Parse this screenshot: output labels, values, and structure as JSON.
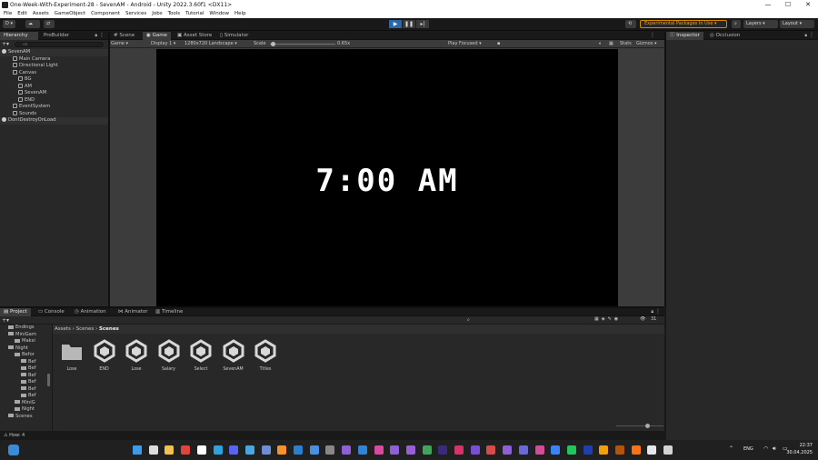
{
  "window": {
    "title": "One-Week-With-Experiment-28 - SevenAM - Android - Unity 2022.3.60f1 <DX11>",
    "min": "—",
    "max": "☐",
    "close": "✕"
  },
  "menu": [
    "File",
    "Edit",
    "Assets",
    "GameObject",
    "Component",
    "Services",
    "Jobs",
    "Tools",
    "Tutorial",
    "Window",
    "Help"
  ],
  "toolbar": {
    "account": "D ▾",
    "experimental": "Experimental Packages In Use ▾",
    "layers": "Layers",
    "layout": "Layout"
  },
  "hierarchy": {
    "tabs": [
      "Hierarchy",
      "ProBuilder"
    ],
    "search_placeholder": "All",
    "items": [
      {
        "label": "SevenAM",
        "indent": 0
      },
      {
        "label": "Main Camera",
        "indent": 2
      },
      {
        "label": "Directional Light",
        "indent": 2
      },
      {
        "label": "Canvas",
        "indent": 2
      },
      {
        "label": "BG",
        "indent": 3
      },
      {
        "label": "AM",
        "indent": 3
      },
      {
        "label": "SevenAM",
        "indent": 3
      },
      {
        "label": "END",
        "indent": 3
      },
      {
        "label": "EventSystem",
        "indent": 2
      },
      {
        "label": "Sounds",
        "indent": 2
      },
      {
        "label": "DontDestroyOnLoad",
        "indent": 0
      }
    ]
  },
  "game": {
    "tabs": [
      "Scene",
      "Game",
      "Asset Store",
      "Simulator"
    ],
    "mode": "Game",
    "display": "Display 1",
    "resolution": "1280x720 Landscape",
    "scale_label": "Scale",
    "scale_value": "0.65x",
    "play_focused": "Play Focused",
    "stats": "Stats",
    "gizmos": "Gizmos",
    "clock_text": "7:00 AM"
  },
  "inspector": {
    "tabs": [
      "Inspector",
      "Occlusion"
    ]
  },
  "project": {
    "tabs": [
      "Project",
      "Console",
      "Animation",
      "Animator",
      "Timeline"
    ],
    "breadcrumb": [
      "Assets",
      "Scenes",
      "Scenes"
    ],
    "count": "31",
    "tree": [
      {
        "label": "Endings",
        "indent": 1
      },
      {
        "label": "MiniGam",
        "indent": 1
      },
      {
        "label": "Maksi",
        "indent": 2
      },
      {
        "label": "Night",
        "indent": 1
      },
      {
        "label": "Befor",
        "indent": 2
      },
      {
        "label": "Bef",
        "indent": 3
      },
      {
        "label": "Bef",
        "indent": 3
      },
      {
        "label": "Bef",
        "indent": 3
      },
      {
        "label": "Bef",
        "indent": 3
      },
      {
        "label": "Bef",
        "indent": 3
      },
      {
        "label": "Bef",
        "indent": 3
      },
      {
        "label": "MiniG",
        "indent": 2
      },
      {
        "label": "Night",
        "indent": 2
      },
      {
        "label": "Scenes",
        "indent": 1
      }
    ],
    "assets": [
      {
        "name": "Lose",
        "kind": "folder"
      },
      {
        "name": "END",
        "kind": "scene"
      },
      {
        "name": "Lose",
        "kind": "scene"
      },
      {
        "name": "Salary",
        "kind": "scene"
      },
      {
        "name": "Select",
        "kind": "scene"
      },
      {
        "name": "SevenAM",
        "kind": "scene"
      },
      {
        "name": "Titles",
        "kind": "scene"
      }
    ]
  },
  "status": {
    "text": "How: 4"
  },
  "taskbar": {
    "lang": "ENG",
    "time": "22:37",
    "date": "30.04.2025"
  }
}
